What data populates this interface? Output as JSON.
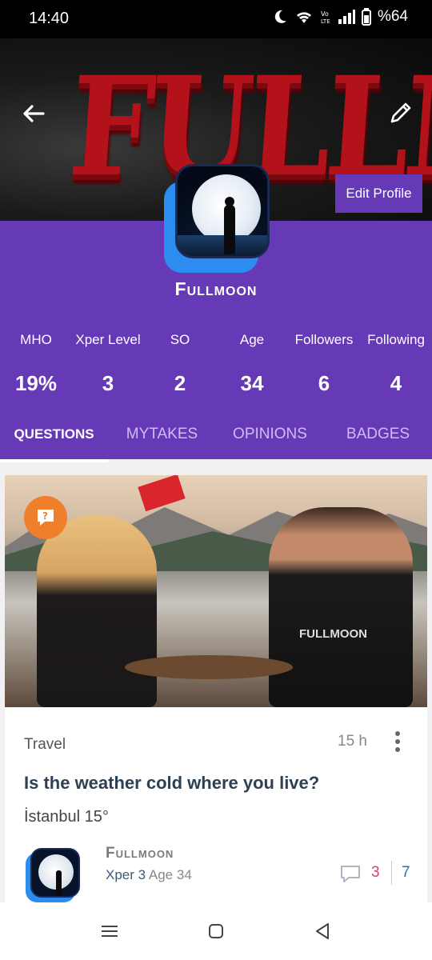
{
  "status_bar": {
    "time": "14:40",
    "battery": "%64",
    "icons": [
      "moon-icon",
      "wifi-icon",
      "volte-icon",
      "signal-icon",
      "battery-icon"
    ]
  },
  "cover": {
    "title": "FULLMOON",
    "edit_profile_label": "Edit Profile"
  },
  "profile": {
    "name": "Fullmoon",
    "stats": [
      {
        "label": "MHO",
        "value": "19%"
      },
      {
        "label": "Xper Level",
        "value": "3"
      },
      {
        "label": "SO",
        "value": "2"
      },
      {
        "label": "Age",
        "value": "34"
      },
      {
        "label": "Followers",
        "value": "6"
      },
      {
        "label": "Following",
        "value": "4"
      }
    ]
  },
  "tabs": [
    {
      "label": "QUESTIONS",
      "active": true
    },
    {
      "label": "MYTAKES",
      "active": false
    },
    {
      "label": "OPINIONS",
      "active": false
    },
    {
      "label": "BADGES",
      "active": false
    }
  ],
  "card": {
    "image_shirt_text": "FULLMOON",
    "category": "Travel",
    "time": "15 h",
    "title": "Is the weather cold where you live?",
    "subtitle": "İstanbul 15°",
    "author": {
      "name": "Fullmoon",
      "xper": "Xper 3",
      "age": "Age 34"
    },
    "comment_count": "3",
    "opinion_count": "7"
  },
  "colors": {
    "brand_purple": "#6639b7",
    "accent_orange": "#f07f2c",
    "avatar_blue": "#2d8cf0",
    "comment_pink": "#d6397e",
    "opinion_blue": "#2b6fb3"
  }
}
